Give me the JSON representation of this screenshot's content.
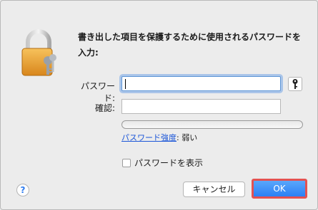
{
  "dialog": {
    "title": "書き出した項目を保護するために使用されるパスワードを入力:",
    "password_label": "パスワード:",
    "verify_label": "確認:",
    "password_value": "",
    "verify_value": "",
    "strength_link": "パスワード強度",
    "strength_sep": ":",
    "strength_value": "弱い",
    "show_password_label": "パスワードを表示",
    "help_label": "?",
    "cancel_label": "キャンセル",
    "ok_label": "OK",
    "colors": {
      "accent": "#2b80f5",
      "highlight": "#e35252",
      "link": "#1a55d8"
    },
    "icons": [
      "lock-icon",
      "key-icon",
      "help-icon"
    ]
  }
}
